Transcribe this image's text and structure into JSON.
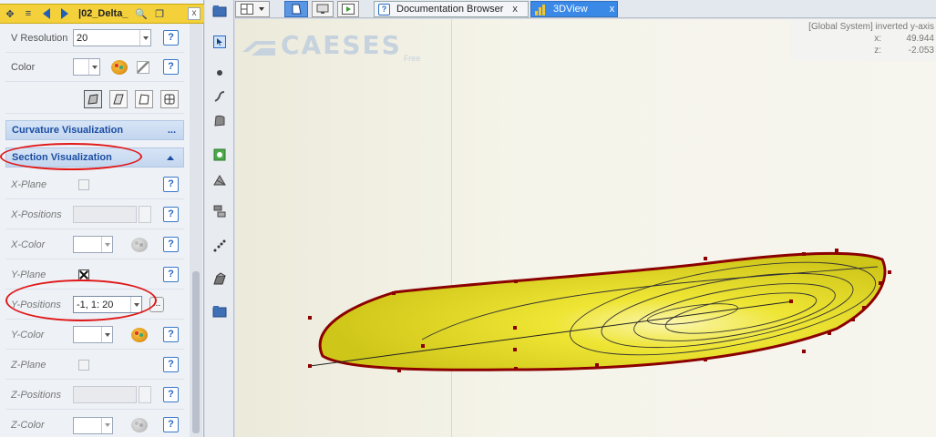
{
  "left_panel": {
    "title": "|02_Delta_",
    "rows": {
      "v_resolution": {
        "label": "V Resolution",
        "value": "20"
      },
      "color": {
        "label": "Color"
      }
    },
    "curvature": {
      "title": "Curvature Visualization",
      "more": "..."
    },
    "section": {
      "title": "Section Visualization",
      "x_plane": "X-Plane",
      "x_positions": "X-Positions",
      "x_color": "X-Color",
      "y_plane": "Y-Plane",
      "y_positions": "Y-Positions",
      "y_positions_value": "-1, 1: 20",
      "y_color": "Y-Color",
      "z_plane": "Z-Plane",
      "z_positions": "Z-Positions",
      "z_color": "Z-Color",
      "more": "..."
    },
    "help": "?"
  },
  "tabs": [
    {
      "label": "Documentation Browser",
      "close": "x",
      "active": false
    },
    {
      "label": "3DView",
      "close": "x",
      "active": true
    }
  ],
  "view": {
    "brand": "CAESES",
    "edition": "Free",
    "coord_title": "[Global System] inverted y-axis",
    "coords": [
      {
        "axis": "x:",
        "value": "49.944"
      },
      {
        "axis": "z:",
        "value": "-2.053"
      }
    ]
  },
  "colors": {
    "accent_blue": "#1b4ea3",
    "surface_yellow": "#e8e41e",
    "outline_red": "#8b0000",
    "highlight_red": "#e01818",
    "title_yellow": "#f4d13a"
  }
}
